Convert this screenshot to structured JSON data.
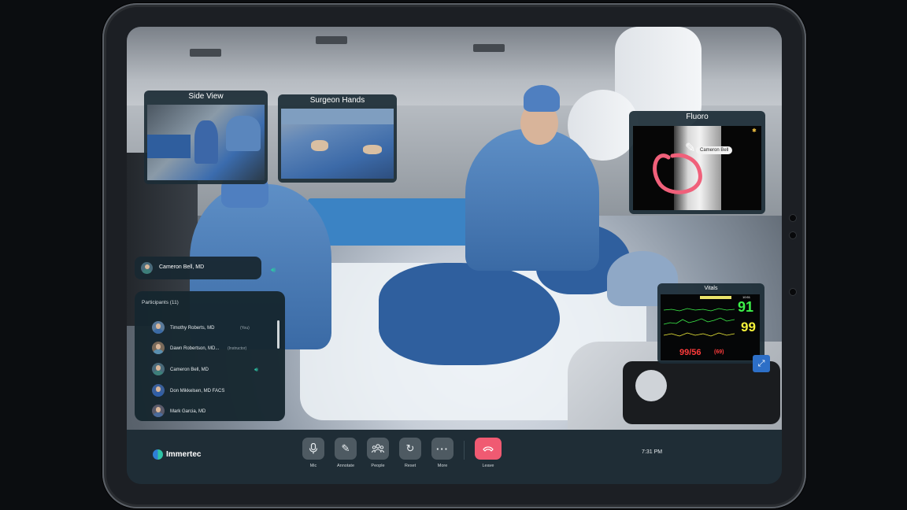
{
  "panels": {
    "side_view": "Side View",
    "surgeon_hands": "Surgeon Hands",
    "fluoro": "Fluoro",
    "fluoro_annotation": "Cameron Bell",
    "vitals": "Vitals"
  },
  "active_speaker": "Cameron Bell, MD",
  "participants": {
    "header": "Participants (11)",
    "items": [
      {
        "name": "Timothy Roberts, MD",
        "tag": "(You)",
        "speaking": false
      },
      {
        "name": "Dawn Robertson, MD...",
        "tag": "(Instructor)",
        "speaking": false
      },
      {
        "name": "Cameron Bell, MD",
        "tag": "",
        "speaking": true
      },
      {
        "name": "Don Mikkelsen, MD FACS",
        "tag": "",
        "speaking": false
      },
      {
        "name": "Mark Garcia, MD",
        "tag": "",
        "speaking": false
      }
    ]
  },
  "vitals": {
    "hr": "91",
    "spo2": "99",
    "bp": "99/56",
    "map": "(69)",
    "clock": "10:51"
  },
  "brand": "Immertec",
  "toolbar": {
    "mic": "Mic",
    "annotate": "Annotate",
    "people": "People",
    "reset": "Reset",
    "more": "More",
    "leave": "Leave"
  },
  "time": "7:31 PM",
  "colors": {
    "accent_teal": "#2ec4a6",
    "leave_red": "#f05a72",
    "annotation_pink": "#f0607a",
    "vitals_green": "#3df04a",
    "vitals_yellow": "#f5f23a",
    "vitals_red": "#ff3b3b"
  }
}
